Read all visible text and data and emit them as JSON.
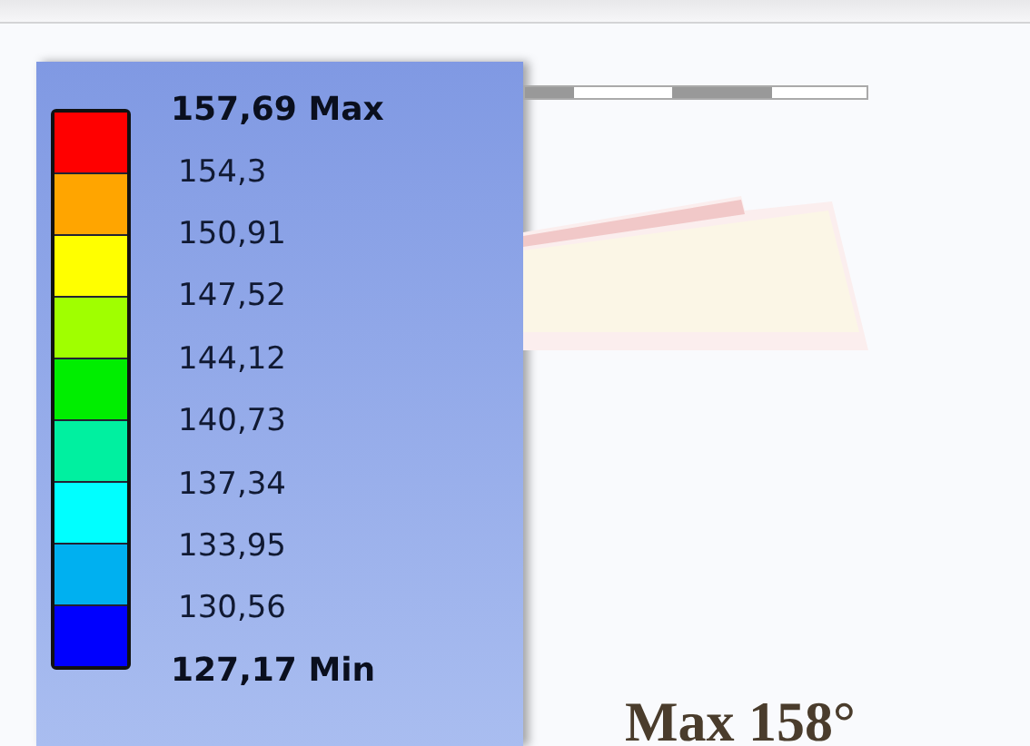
{
  "legend": {
    "bands": [
      {
        "color": "#ff0000"
      },
      {
        "color": "#ffa500"
      },
      {
        "color": "#ffff00"
      },
      {
        "color": "#a0ff00"
      },
      {
        "color": "#00ee00"
      },
      {
        "color": "#00f0a0"
      },
      {
        "color": "#00ffff"
      },
      {
        "color": "#00b0f0"
      },
      {
        "color": "#0000ff"
      }
    ],
    "labels": [
      {
        "text": "157,69 Max",
        "kind": "extreme"
      },
      {
        "text": "154,3",
        "kind": "value"
      },
      {
        "text": "150,91",
        "kind": "value"
      },
      {
        "text": "147,52",
        "kind": "value"
      },
      {
        "text": "144,12",
        "kind": "value"
      },
      {
        "text": "140,73",
        "kind": "value"
      },
      {
        "text": "137,34",
        "kind": "value"
      },
      {
        "text": "133,95",
        "kind": "value"
      },
      {
        "text": "130,56",
        "kind": "value"
      },
      {
        "text": "127,17 Min",
        "kind": "extreme"
      }
    ]
  },
  "caption": "Max 158°"
}
